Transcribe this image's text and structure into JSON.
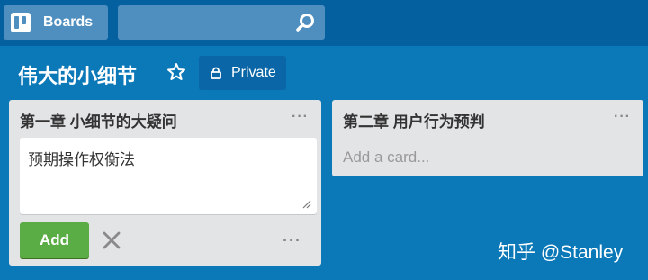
{
  "header": {
    "boards_label": "Boards",
    "search_placeholder": ""
  },
  "board": {
    "title": "伟大的小细节",
    "privacy_label": "Private"
  },
  "lists": [
    {
      "title": "第一章 小细节的大疑问",
      "menu": "···",
      "composer_text": "预期操作权衡法",
      "add_label": "Add",
      "more": "···"
    },
    {
      "title": "第二章 用户行为预判",
      "menu": "···",
      "add_card_label": "Add a card..."
    }
  ],
  "watermark": "知乎 @Stanley",
  "colors": {
    "background": "#0b78b8",
    "topbar": "#0560a0",
    "button": "#4f8fc0",
    "list": "#e2e4e6",
    "add": "#5aac44"
  }
}
